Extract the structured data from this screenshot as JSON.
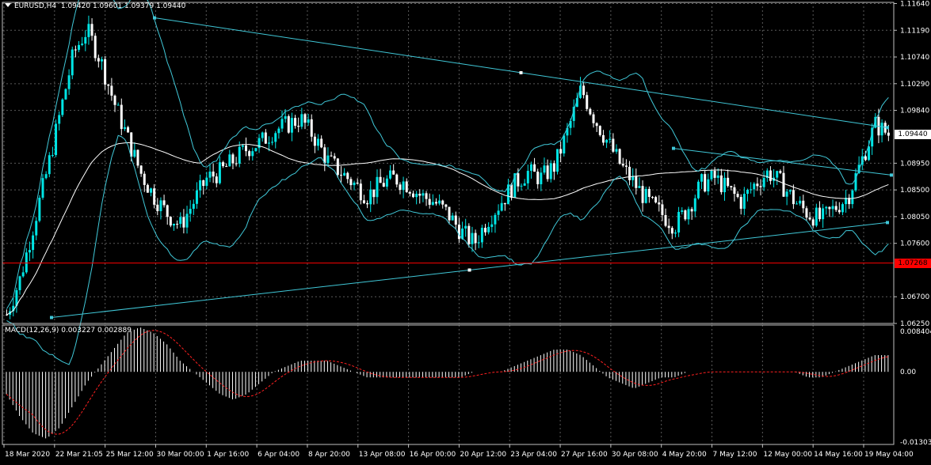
{
  "header": {
    "symbol": "EURUSD,H4",
    "ohlc": "1.09420 1.09601 1.09379 1.09440"
  },
  "indicator": {
    "label": "MACD(12,26,9) 0.003227 0.002889"
  },
  "price_axis": {
    "labels": [
      "1.11640",
      "1.11190",
      "1.10740",
      "1.10290",
      "1.09840",
      "1.09440",
      "1.08950",
      "1.08500",
      "1.08050",
      "1.07600",
      "1.07268",
      "1.06700",
      "1.06250"
    ]
  },
  "current_price": {
    "value": "1.09440",
    "bg": "#ffffff",
    "fg": "#000000"
  },
  "level_line": {
    "value": "1.07268",
    "color": "#ff0000"
  },
  "macd_axis": {
    "labels": [
      "0.008404",
      "0.00",
      "-0.013033"
    ]
  },
  "time_axis": {
    "labels": [
      "18 Mar 2020",
      "22 Mar 21:05",
      "25 Mar 12:00",
      "30 Mar 00:00",
      "1 Apr 16:00",
      "6 Apr 04:00",
      "8 Apr 20:00",
      "13 Apr 08:00",
      "16 Apr 00:00",
      "20 Apr 12:00",
      "23 Apr 04:00",
      "27 Apr 16:00",
      "30 Apr 08:00",
      "4 May 20:00",
      "7 May 12:00",
      "12 May 00:00",
      "14 May 16:00",
      "19 May 04:00"
    ]
  },
  "colors": {
    "background": "#000000",
    "grid": "#5a5a5a",
    "bull_candle": "#00e5e5",
    "bear_candle": "#ffffff",
    "bands": "#40c8d8",
    "trendline": "#40c8d8",
    "moving_average": "#ffffff",
    "macd_hist": "#ffffff",
    "macd_signal": "#ff2020"
  },
  "chart_data": {
    "type": "candlestick",
    "price_range": [
      1.0625,
      1.1166
    ],
    "macd_range": [
      -0.013033,
      0.008404
    ],
    "trend_points": [
      1.064,
      1.07,
      1.079,
      1.088,
      1.098,
      1.108,
      1.112,
      1.107,
      1.1,
      1.094,
      1.088,
      1.084,
      1.081,
      1.079,
      1.083,
      1.087,
      1.088,
      1.09,
      1.092,
      1.093,
      1.095,
      1.096,
      1.097,
      1.094,
      1.09,
      1.088,
      1.086,
      1.084,
      1.086,
      1.087,
      1.086,
      1.084,
      1.083,
      1.081,
      1.078,
      1.076,
      1.08,
      1.083,
      1.086,
      1.088,
      1.087,
      1.089,
      1.095,
      1.102,
      1.097,
      1.093,
      1.089,
      1.086,
      1.083,
      1.081,
      1.079,
      1.082,
      1.086,
      1.087,
      1.085,
      1.083,
      1.086,
      1.088,
      1.086,
      1.083,
      1.081,
      1.08,
      1.082,
      1.084,
      1.09,
      1.096,
      1.0944
    ],
    "macd_hist": [
      -0.004,
      -0.008,
      -0.011,
      -0.012,
      -0.01,
      -0.006,
      -0.002,
      0.001,
      0.004,
      0.007,
      0.008,
      0.007,
      0.005,
      0.002,
      0.0,
      -0.002,
      -0.004,
      -0.005,
      -0.004,
      -0.002,
      0.0,
      0.001,
      0.002,
      0.002,
      0.002,
      0.001,
      0.0,
      -0.001,
      -0.001,
      -0.001,
      -0.001,
      -0.001,
      -0.001,
      -0.001,
      -0.001,
      0.0,
      0.0,
      0.0,
      0.001,
      0.002,
      0.003,
      0.004,
      0.004,
      0.003,
      0.001,
      -0.001,
      -0.002,
      -0.003,
      -0.002,
      -0.001,
      -0.001,
      0.0,
      0.0,
      0.0,
      0.0,
      0.0,
      0.0,
      0.0,
      0.0,
      0.0,
      -0.001,
      -0.001,
      0.0,
      0.001,
      0.002,
      0.003,
      0.003
    ]
  }
}
